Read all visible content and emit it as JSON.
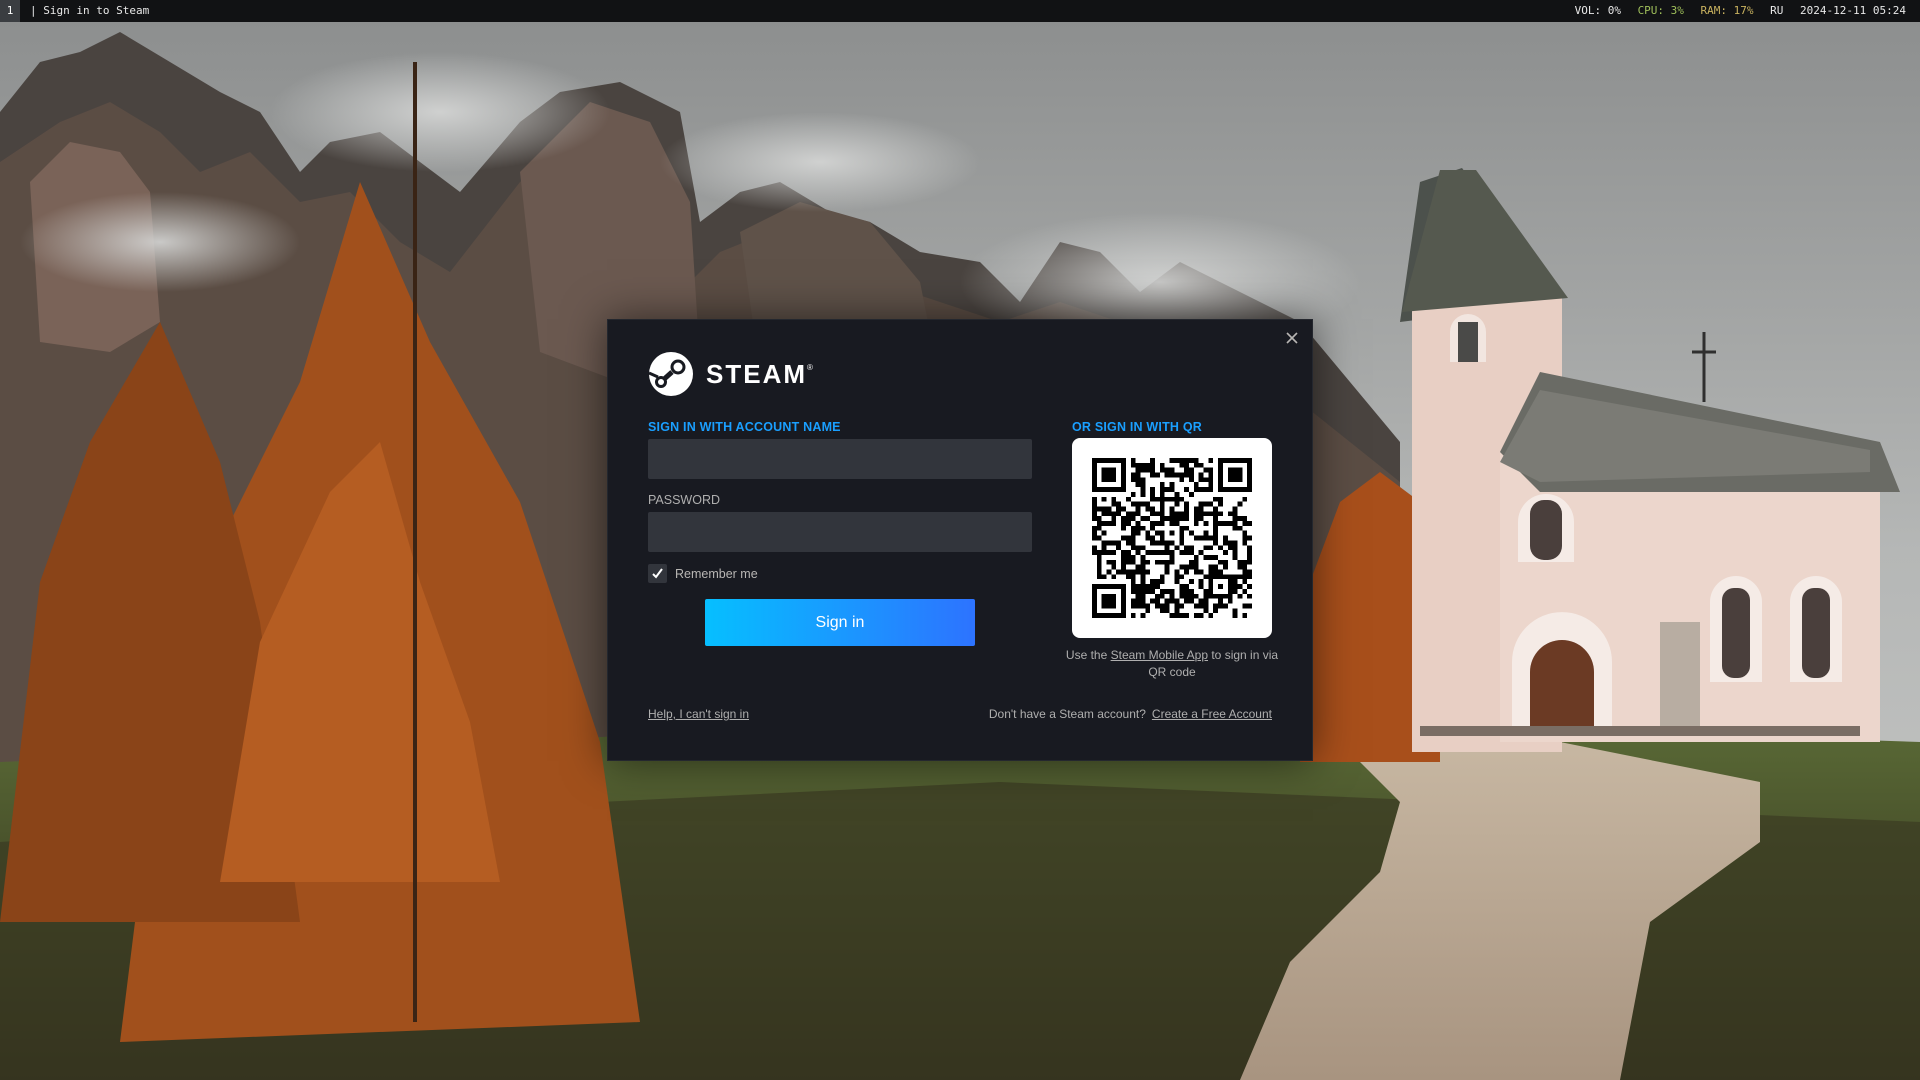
{
  "topbar": {
    "workspace": "1",
    "window_title": "| Sign in to Steam",
    "vol": "VOL: 0%",
    "cpu": "CPU: 3%",
    "ram": "RAM: 17%",
    "layout": "RU",
    "datetime": "2024-12-11 05:24"
  },
  "colors": {
    "accent": "#1a9fff",
    "dialog_bg": "#181a21",
    "input_bg": "#32353c",
    "button_gradient_start": "#06bfff",
    "button_gradient_end": "#2d73ff",
    "cpu_text": "#9fbf5a",
    "ram_text": "#c9b25f"
  },
  "dialog": {
    "logo_text": "STEAM",
    "logo_mark": "®",
    "close_icon": "close-icon",
    "account": {
      "section_label": "SIGN IN WITH ACCOUNT NAME",
      "value": ""
    },
    "password": {
      "label": "PASSWORD",
      "value": ""
    },
    "remember_me": {
      "label": "Remember me",
      "checked": true
    },
    "signin_button": "Sign in",
    "qr": {
      "section_label": "OR SIGN IN WITH QR",
      "caption_prefix": "Use the ",
      "caption_link": "Steam Mobile App",
      "caption_suffix": " to sign in via QR code"
    },
    "help_link": "Help, I can't sign in",
    "no_account_text": "Don't have a Steam account?",
    "create_account_link": "Create a Free Account"
  }
}
